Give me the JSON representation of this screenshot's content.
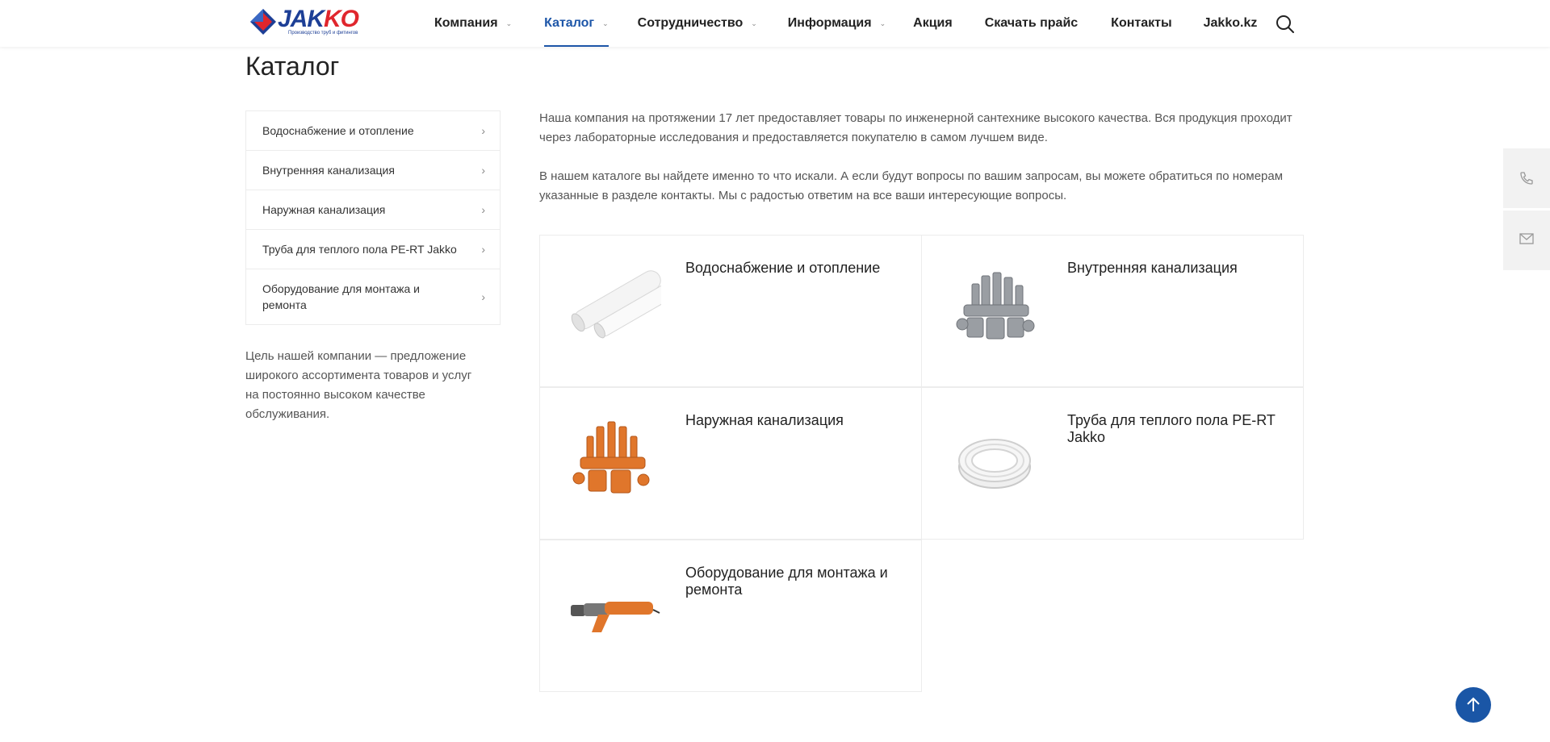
{
  "header": {
    "logo_text": "JAKKO",
    "logo_tagline": "Производство труб и фитингов",
    "nav": [
      {
        "label": "Компания",
        "has_dropdown": true,
        "active": false
      },
      {
        "label": "Каталог",
        "has_dropdown": true,
        "active": true
      },
      {
        "label": "Сотрудничество",
        "has_dropdown": true,
        "active": false
      },
      {
        "label": "Информация",
        "has_dropdown": true,
        "active": false
      },
      {
        "label": "Акция",
        "has_dropdown": false,
        "active": false
      },
      {
        "label": "Скачать прайс",
        "has_dropdown": false,
        "active": false
      },
      {
        "label": "Контакты",
        "has_dropdown": false,
        "active": false
      },
      {
        "label": "Jakko.kz",
        "has_dropdown": false,
        "active": false
      }
    ],
    "search_icon": "search-icon"
  },
  "page_title": "Каталог",
  "sidebar": {
    "items": [
      {
        "label": "Водоснабжение и отопление"
      },
      {
        "label": "Внутренняя канализация"
      },
      {
        "label": "Наружная канализация"
      },
      {
        "label": "Труба для теплого пола PE-RT Jakko"
      },
      {
        "label": "Оборудование для монтажа и ремонта"
      }
    ],
    "text": "Цель нашей компании — предложение широкого ассортимента товаров и услуг на постоянно высоком качестве обслуживания."
  },
  "intro": {
    "p1": "Наша компания на протяжении 17 лет предоставляет товары по инженерной сантехнике высокого качества. Вся продукция проходит через лабораторные исследования и предоставляется покупателю в самом лучшем виде.",
    "p2": "В нашем каталоге вы найдете именно то что искали. А если будут вопросы по вашим запросам, вы можете обратиться по номерам указанные в разделе контакты. Мы с радостью ответим на все ваши интересующие вопросы."
  },
  "catalog": [
    {
      "title": "Водоснабжение и отопление",
      "image": "white-pipes"
    },
    {
      "title": "Внутренняя канализация",
      "image": "gray-fittings"
    },
    {
      "title": "Наружная канализация",
      "image": "orange-fittings"
    },
    {
      "title": "Труба для теплого пола PE-RT Jakko",
      "image": "pipe-coil"
    },
    {
      "title": "Оборудование для монтажа и ремонта",
      "image": "welding-tool"
    }
  ],
  "colors": {
    "brand_blue": "#1d56a8",
    "logo_red": "#e0262d",
    "to_top": "#1a56a6"
  }
}
